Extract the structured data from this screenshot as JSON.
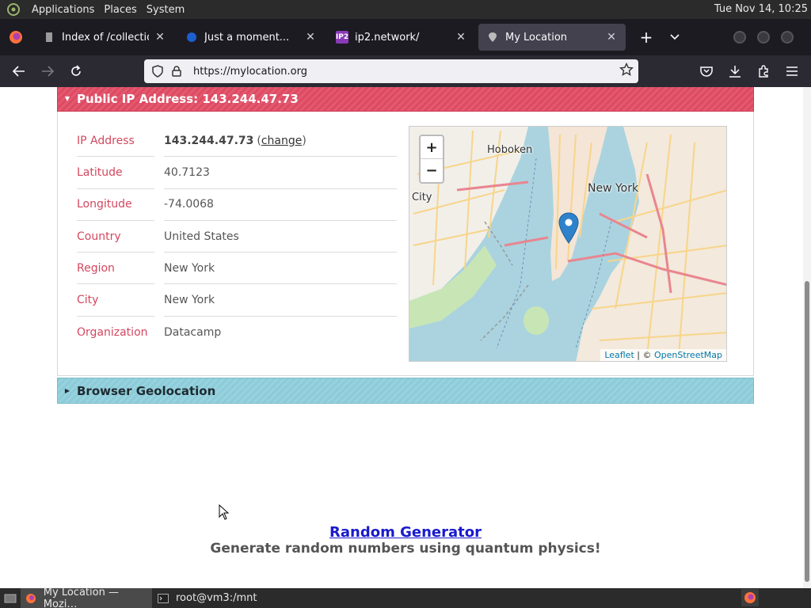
{
  "desktop": {
    "menus": [
      "Applications",
      "Places",
      "System"
    ],
    "clock": "Tue Nov 14, 10:25"
  },
  "browser": {
    "tabs": [
      {
        "label": "Index of /collection/Wi",
        "favicon": "document-icon"
      },
      {
        "label": "Just a moment...",
        "favicon": "globe-icon"
      },
      {
        "label": "ip2.network/",
        "favicon": "ip2-icon",
        "favicon_text": "IP2"
      },
      {
        "label": "My Location",
        "favicon": "location-pin-icon"
      }
    ],
    "url": "https://mylocation.org"
  },
  "page": {
    "ip_panel_title": "Public IP Address: 143.244.47.73",
    "rows": [
      {
        "key": "IP Address",
        "value": "143.244.47.73",
        "link": "change"
      },
      {
        "key": "Latitude",
        "value": "40.7123"
      },
      {
        "key": "Longitude",
        "value": "-74.0068"
      },
      {
        "key": "Country",
        "value": "United States"
      },
      {
        "key": "Region",
        "value": "New York"
      },
      {
        "key": "City",
        "value": "New York"
      },
      {
        "key": "Organization",
        "value": "Datacamp"
      }
    ],
    "map": {
      "zoom_in": "+",
      "zoom_out": "−",
      "places": [
        "Hoboken",
        "New York",
        "City"
      ],
      "attribution_leaflet": "Leaflet",
      "attribution_sep": " | © ",
      "attribution_osm": "OpenStreetMap"
    },
    "geo_panel_title": "Browser Geolocation",
    "footer_link": "Random Generator",
    "footer_subtitle": "Generate random numbers using quantum physics!"
  },
  "taskbar": {
    "tasks": [
      {
        "label": "My Location — Mozi…",
        "icon": "firefox-icon"
      },
      {
        "label": "root@vm3:/mnt",
        "icon": "terminal-icon"
      }
    ]
  },
  "colors": {
    "ip_header": "#de4a62",
    "geo_header": "#8ccbd8",
    "key_text": "#d4475f",
    "link": "#1a1acc"
  }
}
